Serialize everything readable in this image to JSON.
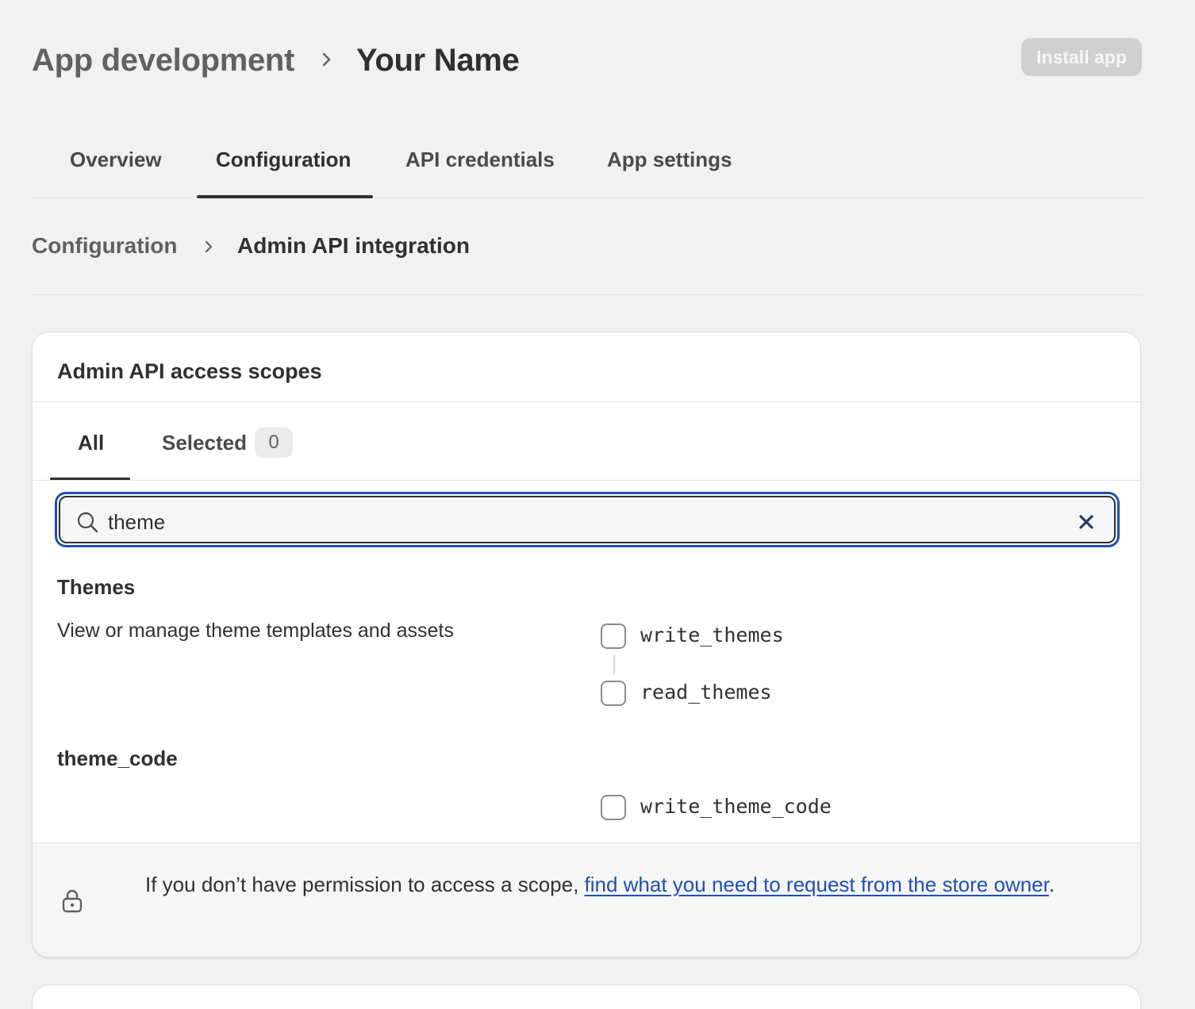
{
  "header": {
    "breadcrumb_root": "App development",
    "breadcrumb_current": "Your Name",
    "install_button": "Install app"
  },
  "tabs": [
    {
      "label": "Overview"
    },
    {
      "label": "Configuration",
      "active": true
    },
    {
      "label": "API credentials"
    },
    {
      "label": "App settings"
    }
  ],
  "subcrumb": {
    "root": "Configuration",
    "current": "Admin API integration"
  },
  "card": {
    "title": "Admin API access scopes",
    "subtabs": {
      "all": "All",
      "selected": "Selected",
      "selected_count": "0"
    },
    "search": {
      "value": "theme"
    },
    "sections": [
      {
        "title": "Themes",
        "description": "View or manage theme templates and assets",
        "scopes": [
          "write_themes",
          "read_themes"
        ]
      },
      {
        "title": "theme_code",
        "description": "",
        "scopes": [
          "write_theme_code"
        ]
      }
    ],
    "footer": {
      "text": "If you don’t have permission to access a scope, ",
      "link": "find what you need to request from the store owner",
      "suffix": "."
    }
  },
  "colors": {
    "background": "#f1f1f1",
    "link": "#1f4fb4",
    "focus_ring": "#1f4fb4",
    "install_button_disabled": "#d0d0d0"
  },
  "icons": [
    "chevron-right-icon",
    "search-icon",
    "close-icon",
    "lock-icon"
  ]
}
